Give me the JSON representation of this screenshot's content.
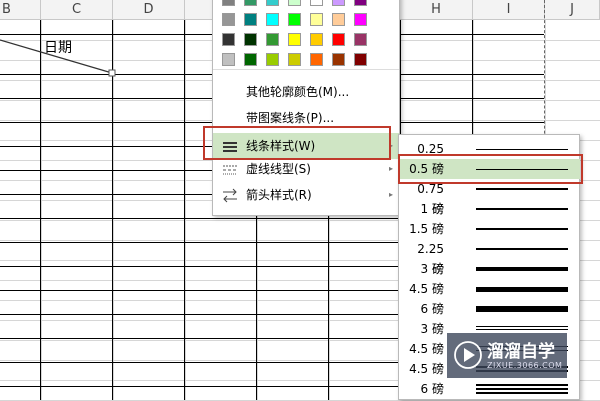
{
  "columns": [
    "B",
    "C",
    "D",
    "H",
    "I",
    "J"
  ],
  "cell_text": "日期",
  "palette": {
    "rows": [
      [
        "#808080",
        "#339966",
        "#33cccc",
        "#ccffcc",
        "#ffffff",
        "#cc99ff",
        "#800080"
      ],
      [
        "#969696",
        "#008080",
        "#00ffff",
        "#00ff00",
        "#ffff99",
        "#ffcc99",
        "#ff00ff"
      ],
      [
        "#333333",
        "#003300",
        "#339933",
        "#ffff00",
        "#ffcc00",
        "#ff0000",
        "#993366"
      ],
      [
        "#c0c0c0",
        "#006600",
        "#99cc00",
        "#cccc00",
        "#ff6600",
        "#993300",
        "#800000"
      ]
    ]
  },
  "menu": {
    "items": [
      {
        "label": "其他轮廓颜色(M)...",
        "icon": "none",
        "arrow": ""
      },
      {
        "label": "带图案线条(P)...",
        "icon": "none",
        "arrow": ""
      },
      {
        "label": "线条样式(W)",
        "icon": "line-weight-icon",
        "arrow": "▸"
      },
      {
        "label": "虚线线型(S)",
        "icon": "dash-style-icon",
        "arrow": "▸"
      },
      {
        "label": "箭头样式(R)",
        "icon": "arrow-style-icon",
        "arrow": "▸"
      }
    ]
  },
  "submenu": {
    "items": [
      {
        "label": "0.25 磅",
        "line": "single"
      },
      {
        "label": "0.5 磅",
        "line": "single"
      },
      {
        "label": "0.75 磅",
        "line": "single"
      },
      {
        "label": "1 磅",
        "line": "single"
      },
      {
        "label": "1.5 磅",
        "line": "single"
      },
      {
        "label": "2.25 磅",
        "line": "single"
      },
      {
        "label": "3 磅",
        "line": "single"
      },
      {
        "label": "4.5 磅",
        "line": "single"
      },
      {
        "label": "6 磅",
        "line": "single"
      },
      {
        "label": "3 磅",
        "line": "double"
      },
      {
        "label": "4.5 磅",
        "line": "double"
      },
      {
        "label": "4.5 磅",
        "line": "double"
      },
      {
        "label": "6 磅",
        "line": "triple"
      }
    ]
  },
  "watermark": {
    "title": "溜溜自学",
    "url": "ZIXUE.3066.COM"
  }
}
